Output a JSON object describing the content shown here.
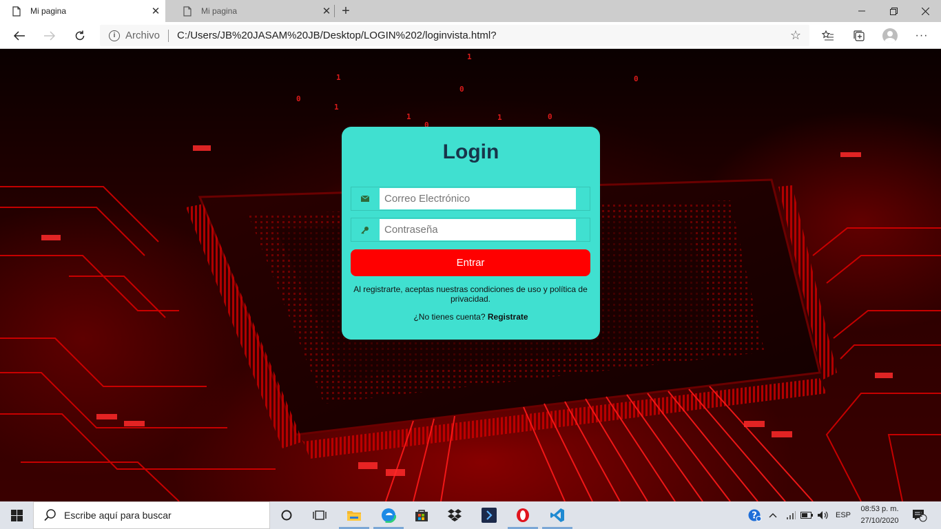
{
  "browser": {
    "tabs": [
      {
        "title": "Mi pagina",
        "active": true
      },
      {
        "title": "Mi pagina",
        "active": false
      }
    ],
    "address": {
      "origin_label": "Archivo",
      "url": "C:/Users/JB%20JASAM%20JB/Desktop/LOGIN%202/loginvista.html?"
    },
    "window_controls": [
      "minimize",
      "restore",
      "close"
    ]
  },
  "login": {
    "title": "Login",
    "email_placeholder": "Correo Electrónico",
    "password_placeholder": "Contraseña",
    "submit_label": "Entrar",
    "terms_text": "Al registrarte, aceptas nuestras condiciones de uso y política de privacidad.",
    "signup_prompt": "¿No tienes cuenta?",
    "signup_link": "Registrate",
    "colors": {
      "card": "#40e0d0",
      "title": "#18344a",
      "button": "#ff0000"
    }
  },
  "background": {
    "theme": "red circuit board",
    "digits": [
      "1",
      "0",
      "0",
      "1",
      "1",
      "0",
      "1",
      "0",
      "0",
      "1"
    ]
  },
  "taskbar": {
    "search_placeholder": "Escribe aquí para buscar",
    "pinned_apps": [
      "task-view",
      "file-explorer",
      "edge",
      "store",
      "dropbox",
      "powershell-like",
      "opera",
      "vscode"
    ],
    "language": "ESP",
    "time": "08:53 p. m.",
    "date": "27/10/2020",
    "notification_count": "1"
  }
}
